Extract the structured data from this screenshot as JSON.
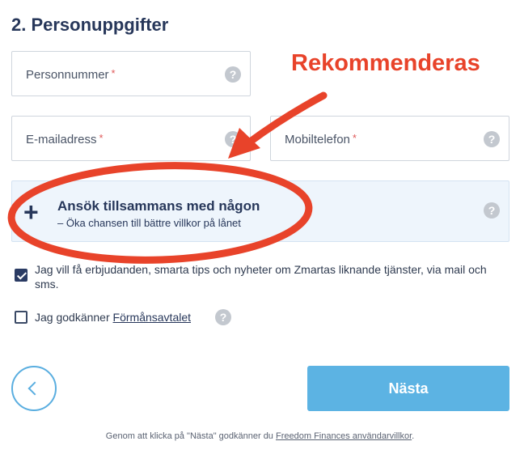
{
  "section": {
    "title": "2. Personuppgifter"
  },
  "fields": {
    "personnummer": {
      "label": "Personnummer",
      "required_mark": "*",
      "help": "?"
    },
    "email": {
      "label": "E-mailadress",
      "required_mark": "*",
      "help": "?"
    },
    "mobil": {
      "label": "Mobiltelefon",
      "required_mark": "*",
      "help": "?"
    }
  },
  "apply_together": {
    "plus": "+",
    "title": "Ansök tillsammans med någon",
    "subtitle": "– Öka chansen till bättre villkor på lånet",
    "help": "?"
  },
  "consents": {
    "marketing": {
      "checked": true,
      "text": "Jag vill få erbjudanden, smarta tips och nyheter om Zmartas liknande tjänster, via mail och sms."
    },
    "agreement": {
      "checked": false,
      "prefix": "Jag godkänner",
      "link": "Förmånsavtalet",
      "help": "?"
    }
  },
  "buttons": {
    "next": "Nästa"
  },
  "footer": {
    "prefix": "Genom att klicka på \"Nästa\" godkänner du",
    "link": "Freedom Finances användarvillkor",
    "suffix": "."
  },
  "annotation": {
    "text": "Rekommenderas",
    "color": "#e8432a"
  },
  "colors": {
    "accent": "#5cb3e3",
    "navy": "#27375a",
    "apply_bg": "#eef5fc"
  }
}
